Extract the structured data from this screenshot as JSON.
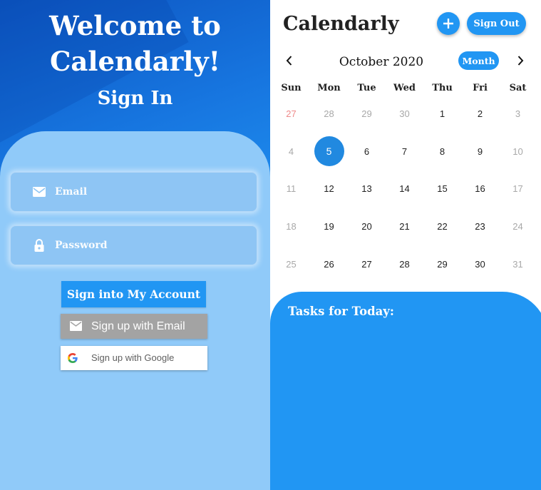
{
  "signin": {
    "welcome_line1": "Welcome to",
    "welcome_line2": "Calendarly!",
    "title": "Sign In",
    "email_placeholder": "Email",
    "password_placeholder": "Password",
    "account_button": "Sign into My Account",
    "email_button": "Sign up with Email",
    "google_button": "Sign up with Google",
    "icons": {
      "email": "mail-icon",
      "password": "lock-icon",
      "email_button": "mail-icon",
      "google_button": "google-logo-icon"
    }
  },
  "calendar_app": {
    "title": "Calendarly",
    "add_button_icon": "plus-icon",
    "signout_button": "Sign Out",
    "month_label": "October 2020",
    "view_button": "Month",
    "prev_icon": "chevron-left-icon",
    "next_icon": "chevron-right-icon",
    "weekdays": [
      "Sun",
      "Mon",
      "Tue",
      "Wed",
      "Thu",
      "Fri",
      "Sat"
    ],
    "weeks": [
      [
        "27",
        "28",
        "29",
        "30",
        "1",
        "2",
        "3"
      ],
      [
        "4",
        "5",
        "6",
        "7",
        "8",
        "9",
        "10"
      ],
      [
        "11",
        "12",
        "13",
        "14",
        "15",
        "16",
        "17"
      ],
      [
        "18",
        "19",
        "20",
        "21",
        "22",
        "23",
        "24"
      ],
      [
        "25",
        "26",
        "27",
        "28",
        "29",
        "30",
        "31"
      ]
    ],
    "selected_day": "5",
    "tasks_title": "Tasks for Today:"
  },
  "colors": {
    "primary": "#2196f3",
    "selected": "#2189e0",
    "card_bg": "#90caf9",
    "weekend_muted": "#a8a8a8",
    "prev_month_sunday": "#ef8a8a",
    "email_button_bg": "#a3a3a3"
  }
}
